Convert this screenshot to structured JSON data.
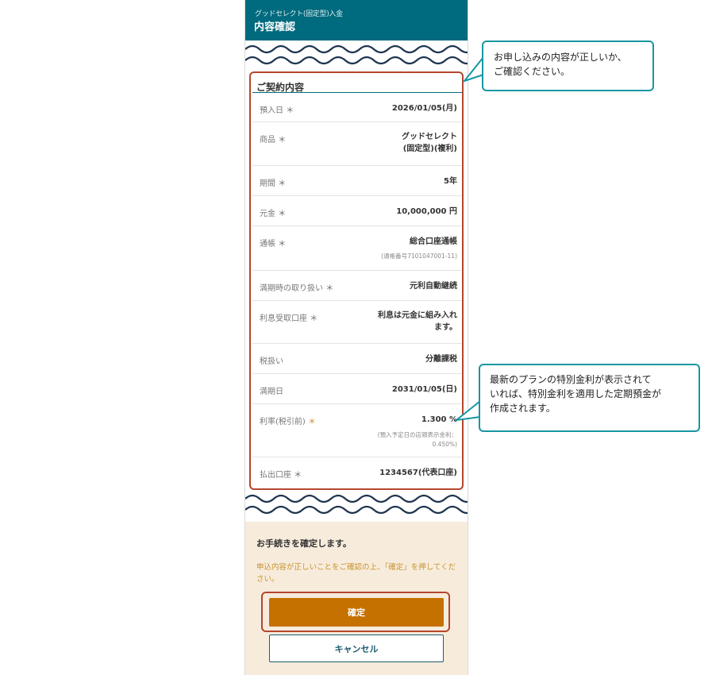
{
  "header": {
    "subtitle": "グッドセレクト(固定型)入金",
    "title": "内容確認"
  },
  "card": {
    "title": "ご契約内容",
    "rows": [
      {
        "label": "預入日",
        "value": "2026/01/05(月)"
      },
      {
        "label": "商品",
        "value_line1": "グッドセレクト",
        "value_line2": "(固定型)(複利)"
      },
      {
        "label": "期間",
        "value": "5年"
      },
      {
        "label": "元金",
        "value": "10,000,000 円"
      },
      {
        "label": "通帳",
        "value": "総合口座通帳",
        "note": "(通帳番号7101047001-11)"
      },
      {
        "label": "満期時の取り扱い",
        "value": "元利自動継続"
      },
      {
        "label": "利息受取口座",
        "value_line1": "利息は元金に組み入れ",
        "value_line2": "ます。"
      },
      {
        "label": "税扱い",
        "value": "分離課税"
      },
      {
        "label": "満期日",
        "value": "2031/01/05(日)"
      },
      {
        "label": "利率(税引前)",
        "value": "1.300 %",
        "note_line1": "(預入予定日の店頭表示金利：",
        "note_line2": "0.450%)"
      },
      {
        "label": "払出口座",
        "value": "1234567(代表口座)"
      }
    ],
    "asterisk": "＊"
  },
  "confirm": {
    "title": "お手続きを確定します。",
    "description": "申込内容が正しいことをご確認の上、「確定」を押してください。",
    "confirm_label": "確定",
    "cancel_label": "キャンセル"
  },
  "callouts": {
    "top_line1": "お申し込みの内容が正しいか、",
    "top_line2": "ご確認ください。",
    "bottom_line1": "最新のプランの特別金利が表示されて",
    "bottom_line2": "いれば、特別金利を適用した定期預金が",
    "bottom_line3": "作成されます。"
  },
  "colors": {
    "header": "#006a7e",
    "primary_button": "#c57100",
    "highlight": "#b5462e",
    "callout_border": "#1896a2",
    "confirm_bg": "#f7ecdc"
  }
}
